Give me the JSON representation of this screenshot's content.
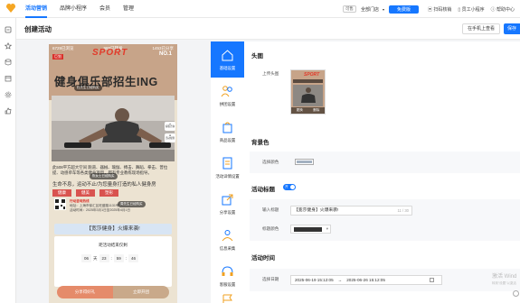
{
  "topbar": {
    "nav": [
      "活动营销",
      "品牌小程序",
      "会员",
      "管理"
    ],
    "badge": "可售",
    "store": "全部门店",
    "free_button": "免费版",
    "links": [
      "扫码核销",
      "员工小程序",
      "帮助中心"
    ]
  },
  "page": {
    "title": "创建活动",
    "preview_button": "在手机上查看",
    "save_button": "保存"
  },
  "phone": {
    "stats": [
      "6729已浏览",
      "989已转发",
      "1453已分享"
    ],
    "sport": "SPORT",
    "no1": "NO.1",
    "tag": "巨划",
    "headline": "健身俱乐部招生ING",
    "buyer1": "杜先生已经购买",
    "chat1": "客服咨询",
    "chat2": "活动规则",
    "desc": "此508平方超大空间 跑道、器械、瑜伽、搏击、舞蹈、拳击、普拉提、动感单车等各类健身项目，都有专业教练现场指导。",
    "buyer2": "陈女士已经购买",
    "slogan": "生命不息，运动不止/为您量身打造的私人健身房",
    "pills": [
      "健康",
      "健美",
      "塑形"
    ],
    "contact_phone": "行动咨询热线",
    "contact_address": "地址：上海市徐汇区旺盛路1131号",
    "contact_date": "活动时间：2025年3月1日至2025年4月1日",
    "buyer3": "周先生已经购买",
    "activity_title": "【宽莎健身】火爆来袭!",
    "countdown_label": "距活动结束仅剩",
    "countdown": {
      "days": "06",
      "day_unit": "天",
      "hours": "23",
      "minutes": "59",
      "seconds": "46",
      "sep": ":"
    },
    "btn_share": "分享得好礼",
    "btn_buy": "立即开团"
  },
  "tabs": [
    {
      "label": "基础设置",
      "icon": "home-icon",
      "active": true
    },
    {
      "label": "拼团设置",
      "icon": "group-icon",
      "active": false
    },
    {
      "label": "商品设置",
      "icon": "bag-icon",
      "active": false
    },
    {
      "label": "活动详情设置",
      "icon": "document-icon",
      "active": false
    },
    {
      "label": "分享设置",
      "icon": "share-icon",
      "active": false
    },
    {
      "label": "信息采集",
      "icon": "form-icon",
      "active": false
    },
    {
      "label": "客服设置",
      "icon": "headset-icon",
      "active": false
    },
    {
      "label": "",
      "icon": "flag-icon",
      "active": false
    }
  ],
  "panel": {
    "head_image_title": "头图",
    "upload_label": "上传头图",
    "thumb_actions": [
      "更换",
      "删除"
    ],
    "bg_color_title": "背景色",
    "bg_color_label": "选择颜色",
    "bg_color": "#a3b1c1",
    "activity_title_section": "活动标题",
    "toggle_text": "开",
    "input_label": "输入标题",
    "title_value": "【宽莎健身】火爆来袭!",
    "title_count": "11 / 30",
    "title_color_label": "标题颜色",
    "title_color": "#333333",
    "time_title": "活动时间",
    "date_label": "选择日期",
    "date_start": "2025-06-19 15:12:05",
    "date_sep": "→",
    "date_end": "2025-06-26 15:12:05"
  },
  "watermark": {
    "line1": "激活 Wind",
    "line2": "转到“设置”以激活"
  },
  "colors": {
    "accent": "#1677ff",
    "banner": "#c7a489",
    "red": "#d9322b"
  }
}
